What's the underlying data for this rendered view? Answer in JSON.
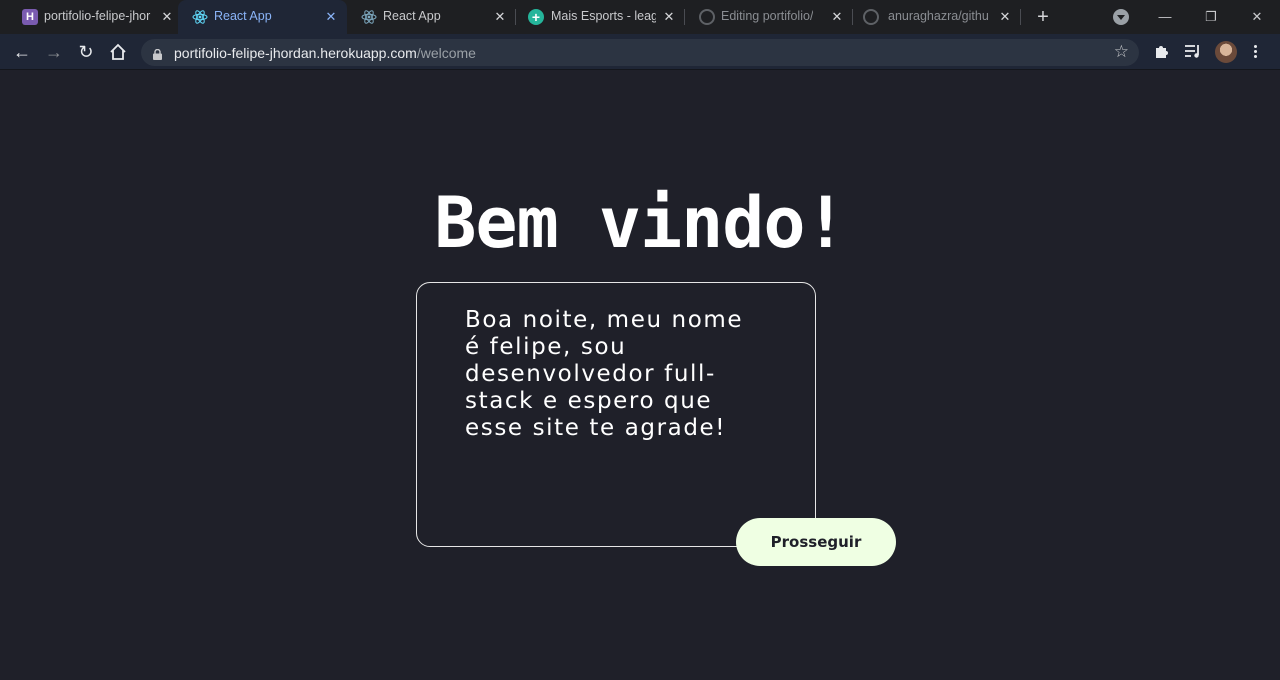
{
  "tabs": [
    {
      "title": "portifolio-felipe-jhor",
      "favicon": "heroku-icon"
    },
    {
      "title": "React App",
      "favicon": "react-icon",
      "active": true
    },
    {
      "title": "React App",
      "favicon": "react-icon"
    },
    {
      "title": "Mais Esports - leag",
      "favicon": "mais-esports-icon"
    },
    {
      "title": "Editing portifolio/R",
      "favicon": "github-icon"
    },
    {
      "title": "anuraghazra/githu",
      "favicon": "github-icon"
    }
  ],
  "address_bar": {
    "host": "portifolio-felipe-jhordan.herokuapp.com",
    "path": "/welcome"
  },
  "page": {
    "heading": "Bem vindo!",
    "message": "Boa noite, meu nome é felipe, sou desenvolvedor full-stack e espero que esse site te agrade!",
    "proceed_label": "Prosseguir"
  },
  "colors": {
    "page_background": "#1f2029",
    "button_background": "#efffe3",
    "card_border": "#e6e6e6",
    "active_tab_text": "#8ab4f8"
  }
}
